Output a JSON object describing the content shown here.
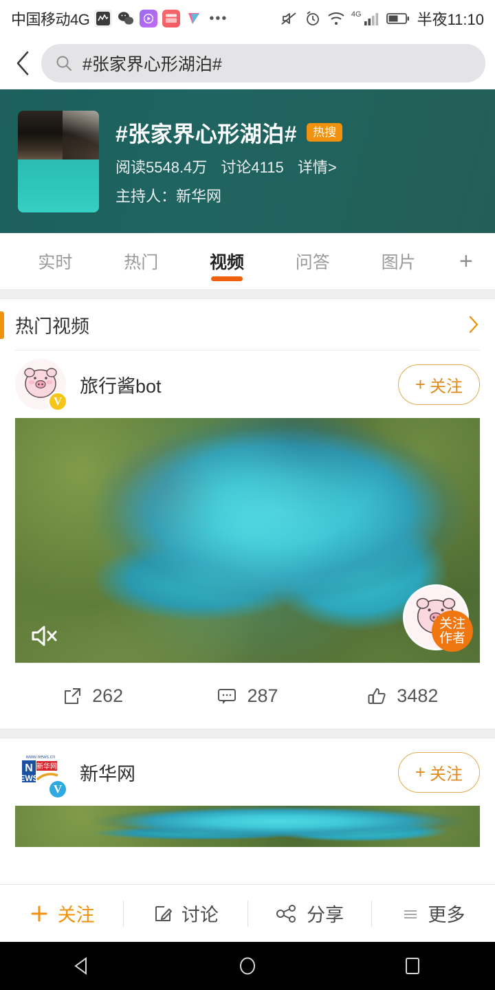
{
  "statusbar": {
    "carrier": "中国移动4G",
    "app_icons": [
      "chart-icon",
      "wechat-icon",
      "video-player-icon",
      "app-red-icon",
      "youku-icon"
    ],
    "overflow": "•••",
    "network_label": "4G",
    "time": "半夜11:10",
    "right_icons": [
      "mute-icon",
      "alarm-icon",
      "wifi-icon",
      "signal-icon",
      "battery-icon"
    ]
  },
  "search": {
    "back_icon": "back-chevron-icon",
    "search_icon": "search-icon",
    "query": "#张家界心形湖泊#"
  },
  "topic": {
    "title": "#张家界心形湖泊#",
    "badge": "热搜",
    "reads": "阅读5548.4万",
    "discussions": "讨论4115",
    "detail": "详情>",
    "host": "主持人：新华网",
    "bg_color": "#1f6460",
    "badge_color": "#f0920f"
  },
  "tabs": {
    "items": [
      {
        "label": "实时",
        "active": false
      },
      {
        "label": "热门",
        "active": false
      },
      {
        "label": "视频",
        "active": true
      },
      {
        "label": "问答",
        "active": false
      },
      {
        "label": "图片",
        "active": false
      }
    ],
    "plus": "+",
    "active_color": "#f0610f"
  },
  "section": {
    "title": "热门视频",
    "chevron": "chevron-right-icon",
    "accent_color": "#f0920f"
  },
  "posts": [
    {
      "author": "旅行酱bot",
      "verified": "V",
      "verified_color": "#f5c518",
      "follow_label": "关注",
      "follow_plus": "+",
      "video": {
        "mute_label": "muted",
        "follow_author_line1": "关注",
        "follow_author_line2": "作者"
      },
      "actions": [
        {
          "icon": "share-icon",
          "count": "262"
        },
        {
          "icon": "comment-icon",
          "count": "287"
        },
        {
          "icon": "like-icon",
          "count": "3482"
        }
      ]
    },
    {
      "author": "新华网",
      "verified": "V",
      "verified_color": "#2eaae0",
      "follow_label": "关注",
      "follow_plus": "+",
      "logo_top": "www.news.cn",
      "logo_main": "新华网",
      "logo_n": "N",
      "logo_ews": "EWS"
    }
  ],
  "bottombar": {
    "items": [
      {
        "label": "关注",
        "icon": "plus-icon",
        "accent": true
      },
      {
        "label": "讨论",
        "icon": "compose-icon",
        "accent": false
      },
      {
        "label": "分享",
        "icon": "share-nodes-icon",
        "accent": false
      },
      {
        "label": "更多",
        "icon": "menu-icon",
        "accent": false
      }
    ]
  },
  "navbar": {
    "back": "nav-back-icon",
    "home": "nav-home-icon",
    "recents": "nav-recents-icon"
  }
}
